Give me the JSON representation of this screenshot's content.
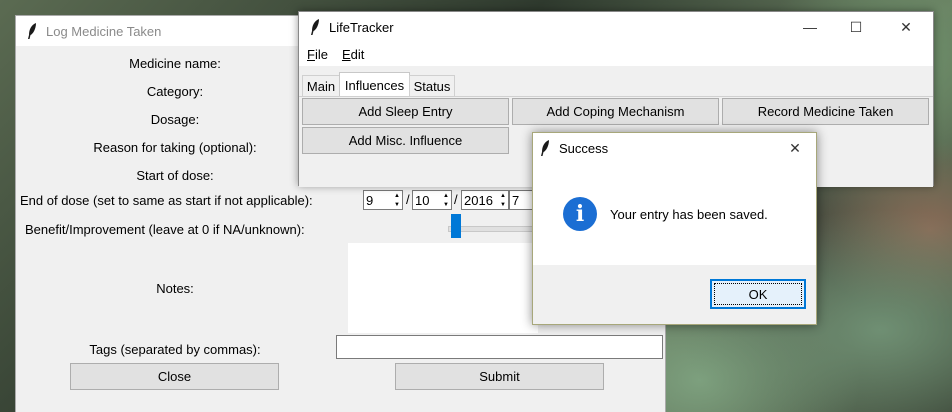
{
  "log_window": {
    "title": "Log Medicine Taken",
    "labels": {
      "medicine_name": "Medicine name:",
      "category": "Category:",
      "dosage": "Dosage:",
      "reason": "Reason for taking (optional):",
      "start_of_dose": "Start of dose:",
      "end_of_dose": "End of dose (set to same as start if not applicable):",
      "benefit": "Benefit/Improvement (leave at 0 if NA/unknown):",
      "notes": "Notes:",
      "tags": "Tags (separated by commas):"
    },
    "end_date": {
      "month": "9",
      "day": "10",
      "year": "2016",
      "extra": "7",
      "sep": "/"
    },
    "benefit_value": 0,
    "tags_value": "",
    "notes_value": "",
    "buttons": {
      "close": "Close",
      "submit": "Submit"
    }
  },
  "lifetracker_window": {
    "title": "LifeTracker",
    "controls": {
      "minimize": "—",
      "maximize": "☐",
      "close": "✕"
    },
    "menu": [
      {
        "accel": "F",
        "rest": "ile"
      },
      {
        "accel": "E",
        "rest": "dit"
      }
    ],
    "tabs": [
      "Main",
      "Influences",
      "Status"
    ],
    "selected_tab": "Influences",
    "buttons": {
      "add_sleep_entry": "Add Sleep Entry",
      "add_coping_mechanism": "Add Coping Mechanism",
      "record_medicine_taken": "Record Medicine Taken",
      "add_misc_influence": "Add Misc. Influence"
    }
  },
  "success_dialog": {
    "title": "Success",
    "close": "✕",
    "icon": "i",
    "message": "Your entry has been saved.",
    "ok_label": "OK"
  },
  "colors": {
    "accent": "#0078d7",
    "info_icon": "#1b6ed3",
    "slider": "#0078d7"
  }
}
